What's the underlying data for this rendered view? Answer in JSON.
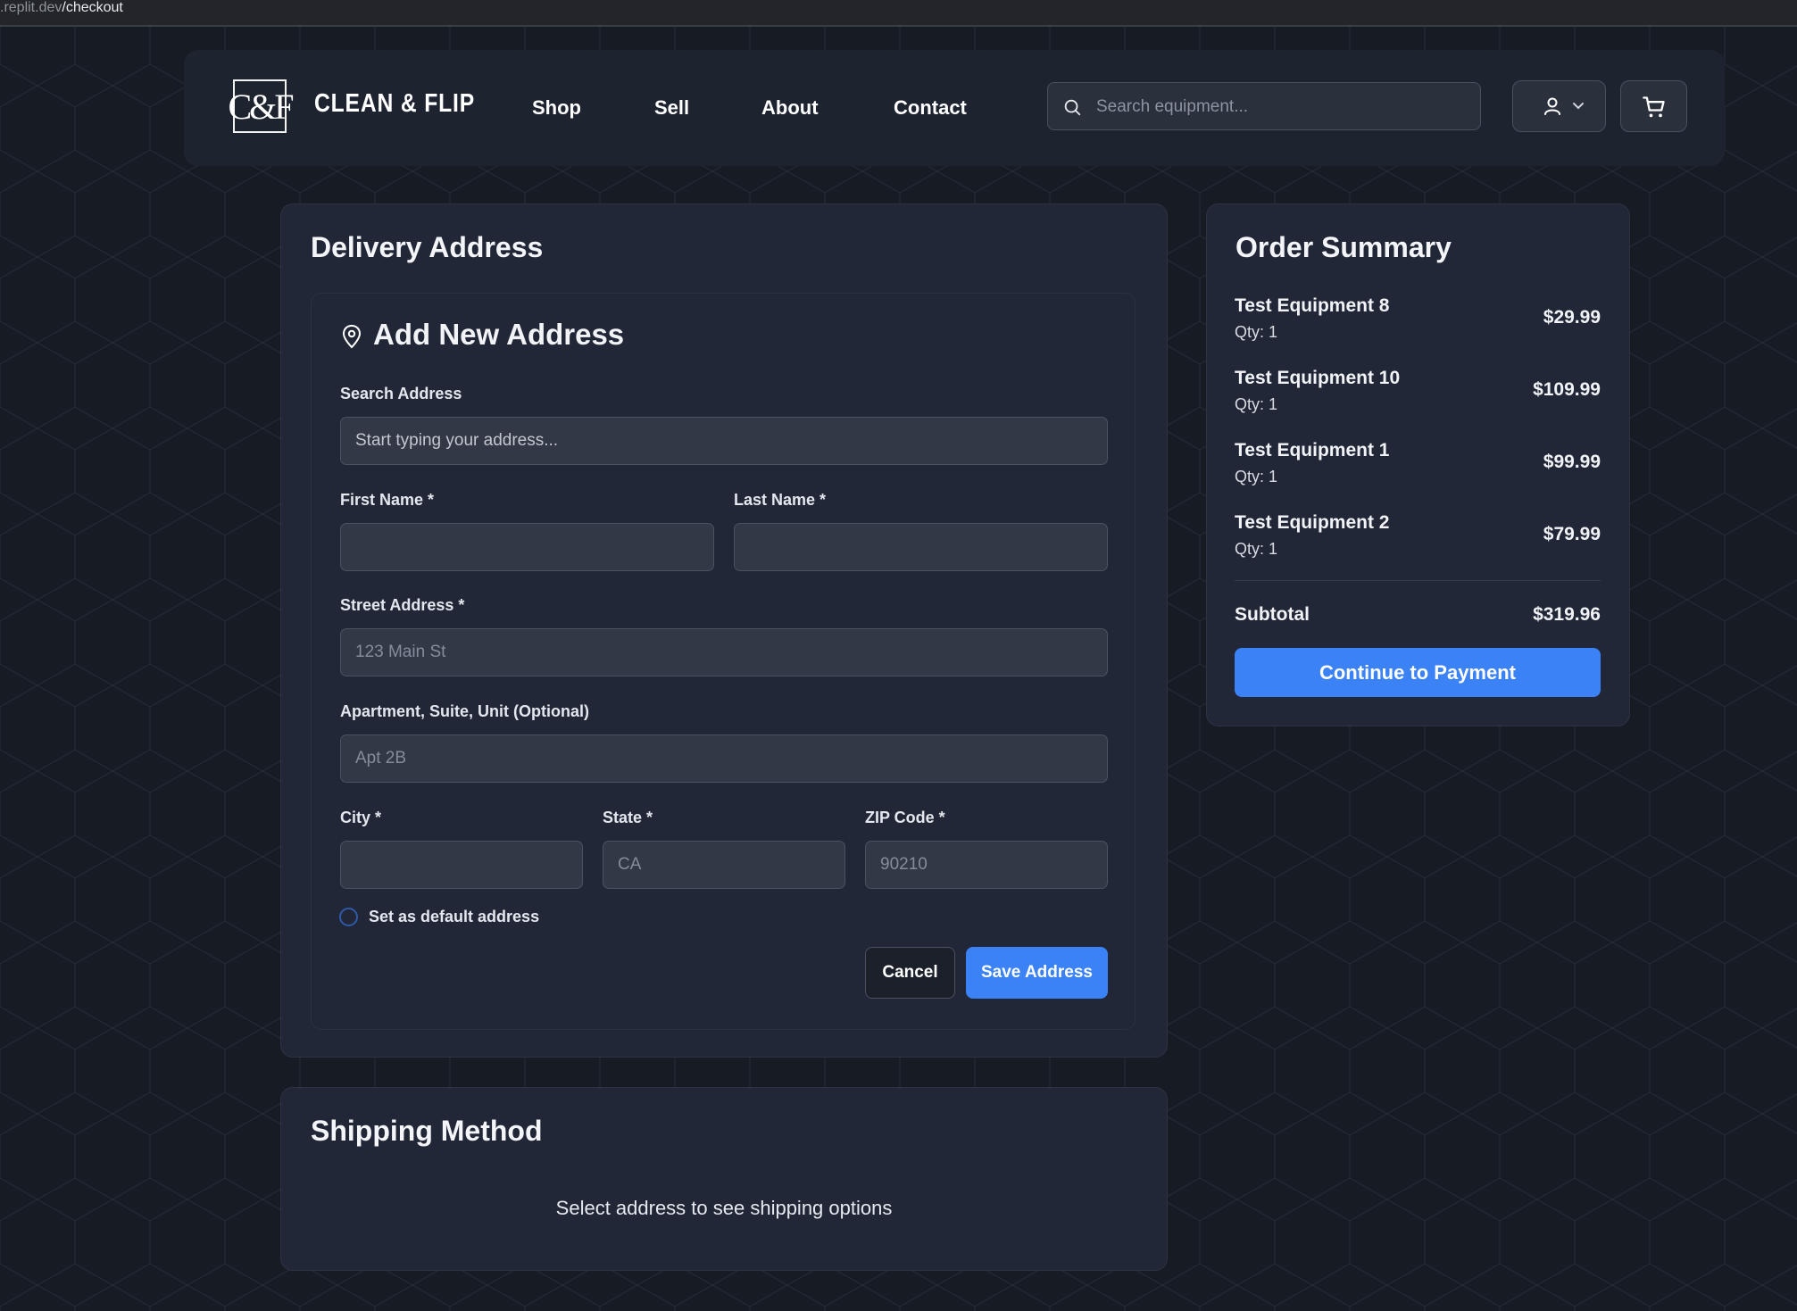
{
  "browser": {
    "host": ".replit.dev",
    "path": "/checkout"
  },
  "header": {
    "logo_text": "C&F",
    "brand": "CLEAN & FLIP",
    "nav": [
      "Shop",
      "Sell",
      "About",
      "Contact"
    ],
    "search_placeholder": "Search equipment..."
  },
  "delivery": {
    "title": "Delivery Address",
    "subtitle": "Add New Address",
    "search_label": "Search Address",
    "search_placeholder": "Start typing your address...",
    "first_name_label": "First Name *",
    "last_name_label": "Last Name *",
    "street_label": "Street Address *",
    "street_placeholder": "123 Main St",
    "apt_label": "Apartment, Suite, Unit (Optional)",
    "apt_placeholder": "Apt 2B",
    "city_label": "City *",
    "state_label": "State *",
    "state_placeholder": "CA",
    "zip_label": "ZIP Code *",
    "zip_placeholder": "90210",
    "default_label": "Set as default address",
    "cancel": "Cancel",
    "save": "Save Address"
  },
  "shipping": {
    "title": "Shipping Method",
    "note": "Select address to see shipping options"
  },
  "summary": {
    "title": "Order Summary",
    "items": [
      {
        "name": "Test Equipment 8",
        "qty": "Qty: 1",
        "price": "$29.99"
      },
      {
        "name": "Test Equipment 10",
        "qty": "Qty: 1",
        "price": "$109.99"
      },
      {
        "name": "Test Equipment 1",
        "qty": "Qty: 1",
        "price": "$99.99"
      },
      {
        "name": "Test Equipment 2",
        "qty": "Qty: 1",
        "price": "$79.99"
      }
    ],
    "subtotal_label": "Subtotal",
    "subtotal_value": "$319.96",
    "pay_button": "Continue to Payment"
  },
  "colors": {
    "accent": "#3b82f6",
    "background": "#171b24",
    "card": "#212736"
  }
}
